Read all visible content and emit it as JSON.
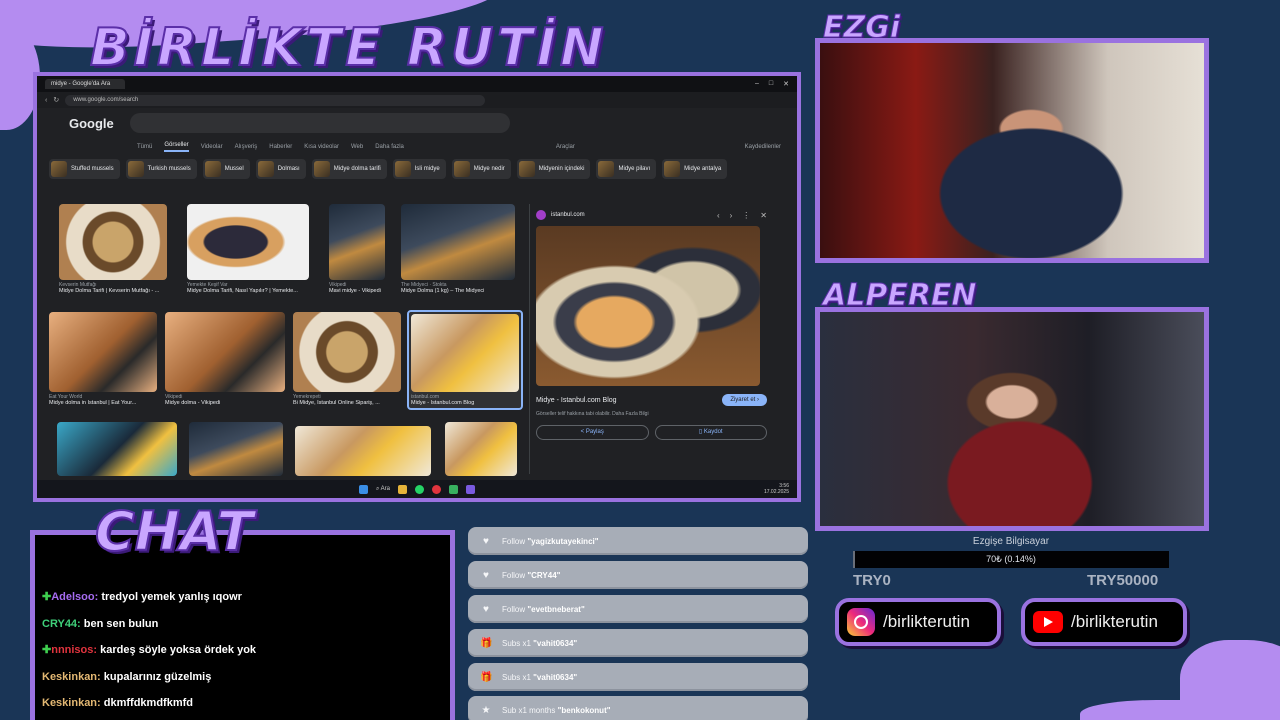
{
  "overlay": {
    "title": "BİRLİKTE RUTİN",
    "chat_title": "CHAT",
    "cam1_label": "EZGi",
    "cam2_label": "ALPEREN"
  },
  "browser": {
    "tab_title": "midye - Google'da Ara",
    "url": "www.google.com/search",
    "logo": "Google",
    "nav": [
      "Tümü",
      "Görseller",
      "Videolar",
      "Alışveriş",
      "Haberler",
      "Kısa videolar",
      "Web",
      "Daha fazla"
    ],
    "tools": "Araçlar",
    "saved": "Kaydedilenler",
    "chips": [
      "Stuffed mussels",
      "Turkish mussels",
      "Mussel",
      "Dolması",
      "Midye dolma tarifi",
      "Isli midye",
      "Midye nedir",
      "Midyenin içindeki",
      "Midye pilavı",
      "Midye antalya"
    ],
    "results": [
      {
        "source": "Kevserin Mutfağı",
        "caption": "Midye Dolma Tarifi | Kevserin Mutfağı - ..."
      },
      {
        "source": "Yemekte Keşif Var",
        "caption": "Midye Dolma Tarifi, Nasıl Yapılır? | Yemekte..."
      },
      {
        "source": "Vikipedi",
        "caption": "Mavi midye - Vikipedi"
      },
      {
        "source": "The Midyeci · Stokta",
        "caption": "Midye Dolma (1 kg) – The Midyeci"
      },
      {
        "source": "Eat Your World",
        "caption": "Midye dolma in Istanbul | Eat Your..."
      },
      {
        "source": "Vikipedi",
        "caption": "Midye dolma - Vikipedi"
      },
      {
        "source": "Yemekrepeti",
        "caption": "Bi Midye, İstanbul Online Sipariş, ..."
      },
      {
        "source": "istanbul.com",
        "caption": "Midye - Istanbul.com Blog"
      }
    ],
    "detail": {
      "site": "istanbul.com",
      "title": "Midye - Istanbul.com Blog",
      "visit": "Ziyaret et",
      "note": "Görseller telif hakkına tabi olabilir.",
      "note_more": "Daha Fazla Bilgi",
      "share": "Paylaş",
      "save": "Kaydot"
    },
    "clock_time": "3:56",
    "clock_date": "17.02.2025",
    "taskbar_search": "Ara"
  },
  "chat": [
    {
      "user": "Adelsoo:",
      "message": "tredyol yemek yanlış ıqowr",
      "color": "#a66cf0",
      "badge": "✚"
    },
    {
      "user": "CRY44:",
      "message": "ben sen bulun",
      "color": "#3fd07a",
      "badge": ""
    },
    {
      "user": "nnnisos:",
      "message": "kardeş söyle yoksa ördek yok",
      "color": "#e0343e",
      "badge": "✚"
    },
    {
      "user": "Keskinkan:",
      "message": "kupalarınız güzelmiş",
      "color": "#e3b873",
      "badge": ""
    },
    {
      "user": "Keskinkan:",
      "message": "dkmffdkmdfkmfd",
      "color": "#e3b873",
      "badge": ""
    }
  ],
  "alerts": [
    {
      "icon": "heart-icon",
      "glyph": "♥",
      "prefix": "Follow",
      "name": "\"yagizkutayekinci\""
    },
    {
      "icon": "heart-icon",
      "glyph": "♥",
      "prefix": "Follow",
      "name": "\"CRY44\""
    },
    {
      "icon": "heart-icon",
      "glyph": "♥",
      "prefix": "Follow",
      "name": "\"evetbneberat\""
    },
    {
      "icon": "gift-icon",
      "glyph": "🎁",
      "prefix": "Subs x1",
      "name": "\"vahit0634\""
    },
    {
      "icon": "gift-icon",
      "glyph": "🎁",
      "prefix": "Subs x1",
      "name": "\"vahit0634\""
    },
    {
      "icon": "star-icon",
      "glyph": "★",
      "prefix": "Sub x1 months",
      "name": "\"benkokonut\""
    }
  ],
  "goal": {
    "title": "Ezgişe Bilgisayar",
    "progress_text": "70₺ (0.14%)",
    "progress_fraction": 0.0014,
    "min": "TRY0",
    "max": "TRY50000"
  },
  "social": {
    "instagram": "/birlikterutin",
    "youtube": "/birlikterutin"
  },
  "colors": {
    "background": "#1a3556",
    "frame": "#9a72e0",
    "accent": "#c9a6ff"
  }
}
